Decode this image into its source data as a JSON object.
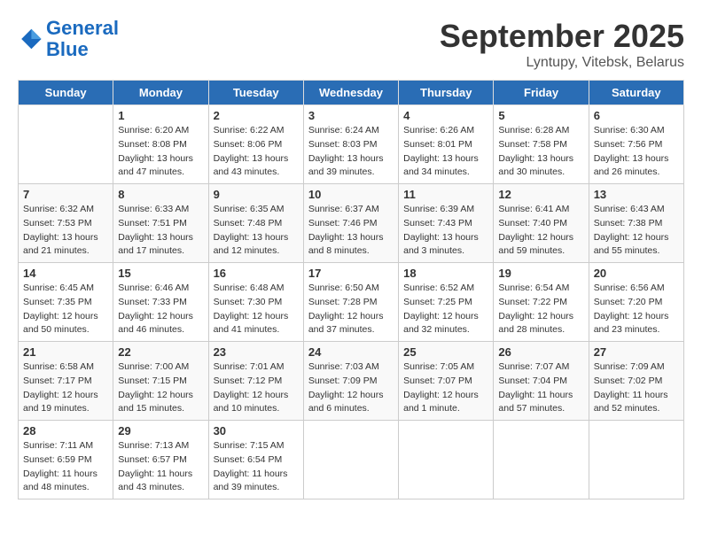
{
  "logo": {
    "line1": "General",
    "line2": "Blue"
  },
  "title": "September 2025",
  "subtitle": "Lyntupy, Vitebsk, Belarus",
  "days_of_week": [
    "Sunday",
    "Monday",
    "Tuesday",
    "Wednesday",
    "Thursday",
    "Friday",
    "Saturday"
  ],
  "weeks": [
    [
      {
        "day": "",
        "content": ""
      },
      {
        "day": "1",
        "content": "Sunrise: 6:20 AM\nSunset: 8:08 PM\nDaylight: 13 hours\nand 47 minutes."
      },
      {
        "day": "2",
        "content": "Sunrise: 6:22 AM\nSunset: 8:06 PM\nDaylight: 13 hours\nand 43 minutes."
      },
      {
        "day": "3",
        "content": "Sunrise: 6:24 AM\nSunset: 8:03 PM\nDaylight: 13 hours\nand 39 minutes."
      },
      {
        "day": "4",
        "content": "Sunrise: 6:26 AM\nSunset: 8:01 PM\nDaylight: 13 hours\nand 34 minutes."
      },
      {
        "day": "5",
        "content": "Sunrise: 6:28 AM\nSunset: 7:58 PM\nDaylight: 13 hours\nand 30 minutes."
      },
      {
        "day": "6",
        "content": "Sunrise: 6:30 AM\nSunset: 7:56 PM\nDaylight: 13 hours\nand 26 minutes."
      }
    ],
    [
      {
        "day": "7",
        "content": "Sunrise: 6:32 AM\nSunset: 7:53 PM\nDaylight: 13 hours\nand 21 minutes."
      },
      {
        "day": "8",
        "content": "Sunrise: 6:33 AM\nSunset: 7:51 PM\nDaylight: 13 hours\nand 17 minutes."
      },
      {
        "day": "9",
        "content": "Sunrise: 6:35 AM\nSunset: 7:48 PM\nDaylight: 13 hours\nand 12 minutes."
      },
      {
        "day": "10",
        "content": "Sunrise: 6:37 AM\nSunset: 7:46 PM\nDaylight: 13 hours\nand 8 minutes."
      },
      {
        "day": "11",
        "content": "Sunrise: 6:39 AM\nSunset: 7:43 PM\nDaylight: 13 hours\nand 3 minutes."
      },
      {
        "day": "12",
        "content": "Sunrise: 6:41 AM\nSunset: 7:40 PM\nDaylight: 12 hours\nand 59 minutes."
      },
      {
        "day": "13",
        "content": "Sunrise: 6:43 AM\nSunset: 7:38 PM\nDaylight: 12 hours\nand 55 minutes."
      }
    ],
    [
      {
        "day": "14",
        "content": "Sunrise: 6:45 AM\nSunset: 7:35 PM\nDaylight: 12 hours\nand 50 minutes."
      },
      {
        "day": "15",
        "content": "Sunrise: 6:46 AM\nSunset: 7:33 PM\nDaylight: 12 hours\nand 46 minutes."
      },
      {
        "day": "16",
        "content": "Sunrise: 6:48 AM\nSunset: 7:30 PM\nDaylight: 12 hours\nand 41 minutes."
      },
      {
        "day": "17",
        "content": "Sunrise: 6:50 AM\nSunset: 7:28 PM\nDaylight: 12 hours\nand 37 minutes."
      },
      {
        "day": "18",
        "content": "Sunrise: 6:52 AM\nSunset: 7:25 PM\nDaylight: 12 hours\nand 32 minutes."
      },
      {
        "day": "19",
        "content": "Sunrise: 6:54 AM\nSunset: 7:22 PM\nDaylight: 12 hours\nand 28 minutes."
      },
      {
        "day": "20",
        "content": "Sunrise: 6:56 AM\nSunset: 7:20 PM\nDaylight: 12 hours\nand 23 minutes."
      }
    ],
    [
      {
        "day": "21",
        "content": "Sunrise: 6:58 AM\nSunset: 7:17 PM\nDaylight: 12 hours\nand 19 minutes."
      },
      {
        "day": "22",
        "content": "Sunrise: 7:00 AM\nSunset: 7:15 PM\nDaylight: 12 hours\nand 15 minutes."
      },
      {
        "day": "23",
        "content": "Sunrise: 7:01 AM\nSunset: 7:12 PM\nDaylight: 12 hours\nand 10 minutes."
      },
      {
        "day": "24",
        "content": "Sunrise: 7:03 AM\nSunset: 7:09 PM\nDaylight: 12 hours\nand 6 minutes."
      },
      {
        "day": "25",
        "content": "Sunrise: 7:05 AM\nSunset: 7:07 PM\nDaylight: 12 hours\nand 1 minute."
      },
      {
        "day": "26",
        "content": "Sunrise: 7:07 AM\nSunset: 7:04 PM\nDaylight: 11 hours\nand 57 minutes."
      },
      {
        "day": "27",
        "content": "Sunrise: 7:09 AM\nSunset: 7:02 PM\nDaylight: 11 hours\nand 52 minutes."
      }
    ],
    [
      {
        "day": "28",
        "content": "Sunrise: 7:11 AM\nSunset: 6:59 PM\nDaylight: 11 hours\nand 48 minutes."
      },
      {
        "day": "29",
        "content": "Sunrise: 7:13 AM\nSunset: 6:57 PM\nDaylight: 11 hours\nand 43 minutes."
      },
      {
        "day": "30",
        "content": "Sunrise: 7:15 AM\nSunset: 6:54 PM\nDaylight: 11 hours\nand 39 minutes."
      },
      {
        "day": "",
        "content": ""
      },
      {
        "day": "",
        "content": ""
      },
      {
        "day": "",
        "content": ""
      },
      {
        "day": "",
        "content": ""
      }
    ]
  ]
}
